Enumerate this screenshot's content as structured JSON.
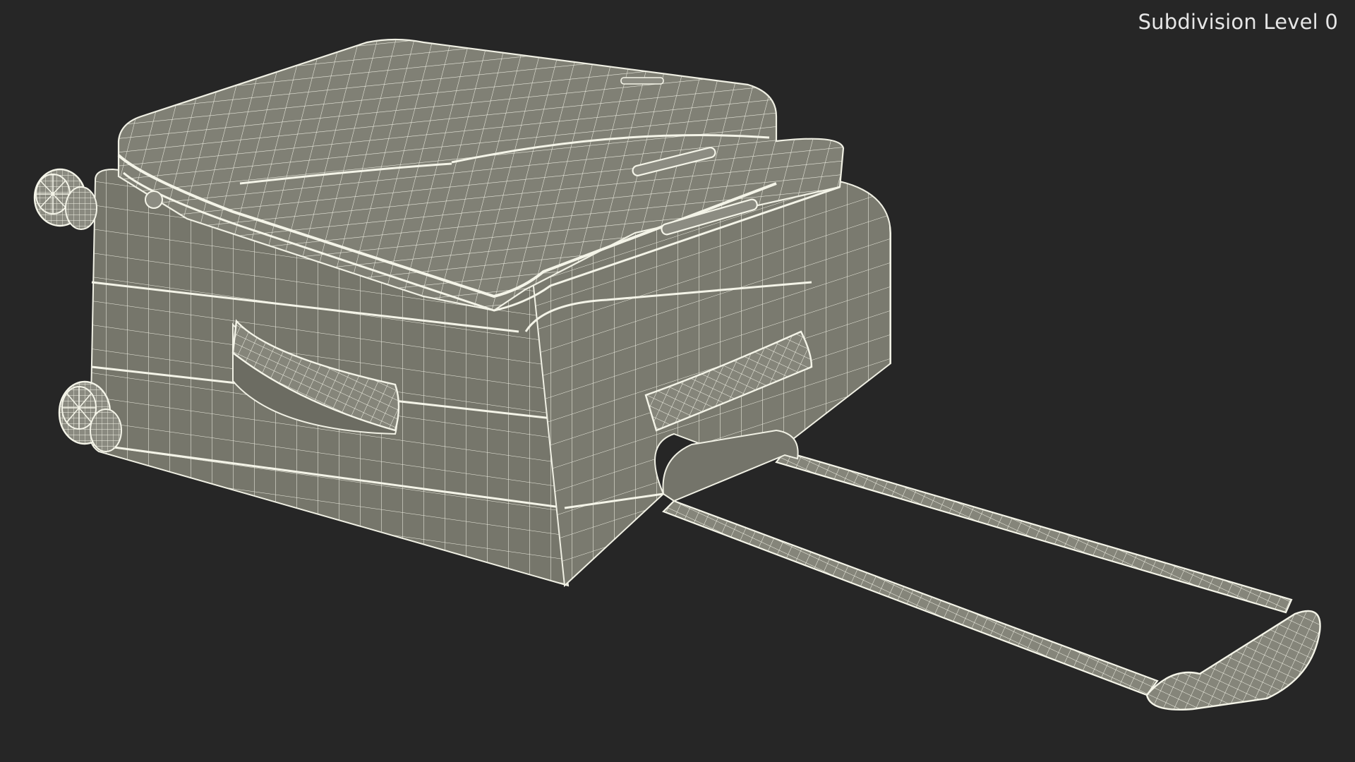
{
  "overlay": {
    "subdivision_label": "Subdivision Level 0"
  },
  "scene": {
    "subject": "suitcase-wireframe",
    "background_color": "#262626",
    "surface_color": "#7d7d72",
    "surface_dark_color": "#5f5f55",
    "wire_color": "#f2f2e6"
  }
}
